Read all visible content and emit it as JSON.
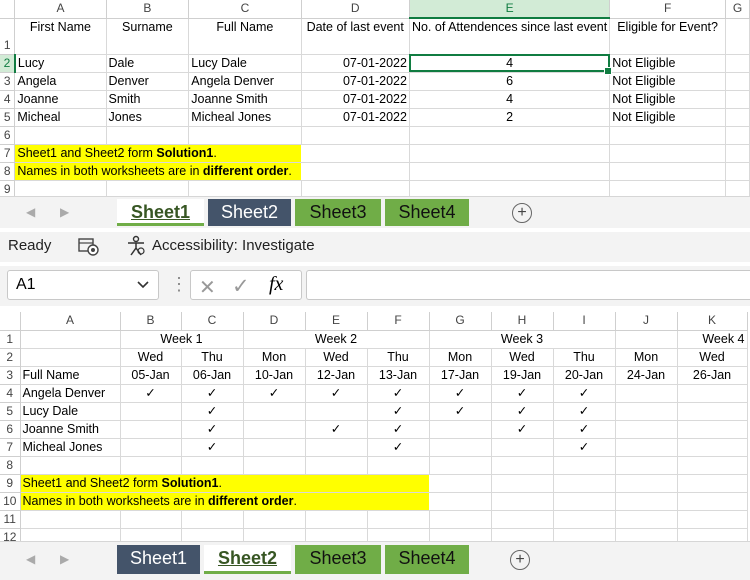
{
  "sheet1": {
    "col_letters": [
      "A",
      "B",
      "C",
      "D",
      "E",
      "F",
      "G"
    ],
    "row_numbers": [
      "1",
      "2",
      "3",
      "4",
      "5",
      "6",
      "7",
      "8",
      "9"
    ],
    "headers": {
      "first_name": "First Name",
      "surname": "Surname",
      "full_name": "Full Name",
      "date": "Date of last event",
      "attendances": "No. of Attendences since last event",
      "eligible": "Eligible for Event?"
    },
    "rows": [
      {
        "first": "Lucy",
        "surname": "Dale",
        "full": "Lucy Dale",
        "date": "07-01-2022",
        "count": "4",
        "eligible": "Not Eligible"
      },
      {
        "first": "Angela",
        "surname": "Denver",
        "full": "Angela Denver",
        "date": "07-01-2022",
        "count": "6",
        "eligible": "Not Eligible"
      },
      {
        "first": "Joanne",
        "surname": "Smith",
        "full": "Joanne Smith",
        "date": "07-01-2022",
        "count": "4",
        "eligible": "Not Eligible"
      },
      {
        "first": "Micheal",
        "surname": "Jones",
        "full": "Micheal Jones",
        "date": "07-01-2022",
        "count": "2",
        "eligible": "Not Eligible"
      }
    ],
    "note1_pre": "Sheet1 and Sheet2 form ",
    "note1_bold": "Solution1",
    "note1_post": ".",
    "note2_pre": "Names in both worksheets are in ",
    "note2_bold": "different order",
    "note2_post": "."
  },
  "tabs_top": [
    {
      "label": "Sheet1",
      "state": "active"
    },
    {
      "label": "Sheet2",
      "state": "navy"
    },
    {
      "label": "Sheet3",
      "state": "green"
    },
    {
      "label": "Sheet4",
      "state": "green"
    }
  ],
  "status": {
    "ready": "Ready",
    "accessibility": "Accessibility: Investigate"
  },
  "formula_bar": {
    "name_box": "A1",
    "fx": "fx",
    "content": ""
  },
  "sheet2": {
    "col_letters": [
      "A",
      "B",
      "C",
      "D",
      "E",
      "F",
      "G",
      "H",
      "I",
      "J",
      "K"
    ],
    "row_numbers": [
      "1",
      "2",
      "3",
      "4",
      "5",
      "6",
      "7",
      "8",
      "9",
      "10",
      "11",
      "12"
    ],
    "weeks": {
      "w1": "Week 1",
      "w2": "Week 2",
      "w3": "Week 3",
      "w4": "Week 4"
    },
    "days": [
      "Wed",
      "Thu",
      "Mon",
      "Wed",
      "Thu",
      "Mon",
      "Wed",
      "Thu",
      "Mon",
      "Wed"
    ],
    "full_name_label": "Full Name",
    "dates": [
      "05-Jan",
      "06-Jan",
      "10-Jan",
      "12-Jan",
      "13-Jan",
      "17-Jan",
      "19-Jan",
      "20-Jan",
      "24-Jan",
      "26-Jan"
    ],
    "check": "✓",
    "people": [
      {
        "name": "Angela Denver",
        "marks": [
          1,
          1,
          1,
          1,
          1,
          1,
          1,
          1,
          0,
          0
        ]
      },
      {
        "name": "Lucy Dale",
        "marks": [
          0,
          1,
          0,
          0,
          1,
          1,
          1,
          1,
          0,
          0
        ]
      },
      {
        "name": "Joanne Smith",
        "marks": [
          0,
          1,
          0,
          1,
          1,
          0,
          1,
          1,
          0,
          0
        ]
      },
      {
        "name": "Micheal Jones",
        "marks": [
          0,
          1,
          0,
          0,
          1,
          0,
          0,
          1,
          0,
          0
        ]
      }
    ],
    "note1_pre": "Sheet1 and Sheet2 form ",
    "note1_bold": "Solution1",
    "note1_post": ".",
    "note2_pre": "Names in both worksheets are in ",
    "note2_bold": "different order",
    "note2_post": "."
  },
  "tabs_bottom": [
    {
      "label": "Sheet1",
      "state": "navy"
    },
    {
      "label": "Sheet2",
      "state": "active"
    },
    {
      "label": "Sheet3",
      "state": "green"
    },
    {
      "label": "Sheet4",
      "state": "green"
    }
  ],
  "icons": {
    "plus": "+",
    "nav_left": "◀",
    "nav_right": "▶",
    "chevron": "⌄",
    "more": "⋮",
    "cancel": "✕",
    "enter": "✓"
  }
}
